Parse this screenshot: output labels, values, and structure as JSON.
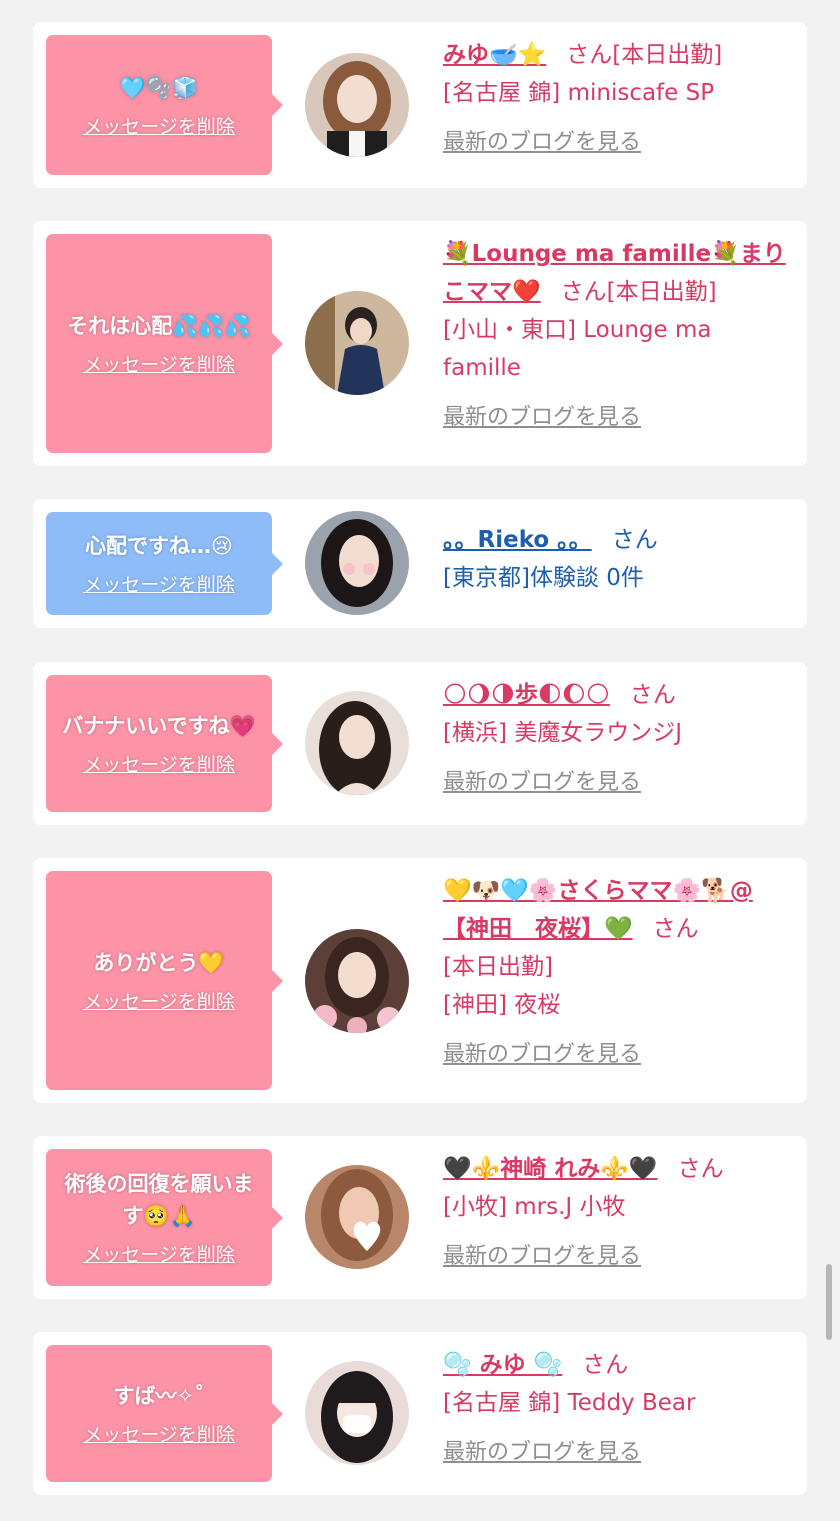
{
  "delete_label": "メッセージを削除",
  "blog_label": "最新のブログを見る",
  "san": "さん",
  "colors": {
    "pink_bubble": "#fc93a7",
    "blue_bubble": "#8ebcf9",
    "name_pink": "#d83a64",
    "name_blue": "#1d5fae",
    "blog_gray": "#8f8f8f"
  },
  "entries": [
    {
      "message": "🩵🫧🧊",
      "name": "みゆ🥣⭐",
      "status": "[本日出勤]",
      "location": "[名古屋 錦] miniscafe SP",
      "has_blog": true,
      "theme": "pink",
      "avatar": "woman-brown-hair-photo"
    },
    {
      "message": "それは心配💦💦💦",
      "name": "💐Lounge ma famille💐まりこママ❤️",
      "status": "[本日出勤]",
      "location": "[小山・東口] Lounge ma famille",
      "has_blog": true,
      "theme": "pink",
      "avatar": "woman-kimono-photo"
    },
    {
      "message": "心配ですね…😢",
      "name": "。。Rieko 。。",
      "status": "",
      "location": "[東京都]体験談 0件",
      "has_blog": false,
      "theme": "blue",
      "avatar": "woman-dark-hair-photo"
    },
    {
      "message": "バナナいいですね💗",
      "name": "🌕🌖🌗歩🌓🌔🌕",
      "status": "",
      "location": "[横浜] 美魔女ラウンジJ",
      "has_blog": true,
      "theme": "pink",
      "avatar": "woman-portrait-photo"
    },
    {
      "message": "ありがとう💛",
      "name": "💛🐶🩵🌸さくらママ🌸🐕@【神田　夜桜】💚",
      "status": "[本日出勤]",
      "location": "[神田] 夜桜",
      "has_blog": true,
      "theme": "pink",
      "avatar": "woman-blossom-photo"
    },
    {
      "message": "術後の回復を願います🥺🙏",
      "name": "🖤⚜️神崎 れみ⚜️🖤",
      "status": "",
      "location": "[小牧] mrs.J 小牧",
      "has_blog": true,
      "theme": "pink",
      "avatar": "woman-heart-sticker-photo"
    },
    {
      "message": "すば〰︎✧︎˚",
      "name": "🫧 みゆ 🫧",
      "status": "",
      "location": "[名古屋 錦] Teddy Bear",
      "has_blog": true,
      "theme": "pink",
      "avatar": "woman-bangs-mask-photo"
    }
  ]
}
